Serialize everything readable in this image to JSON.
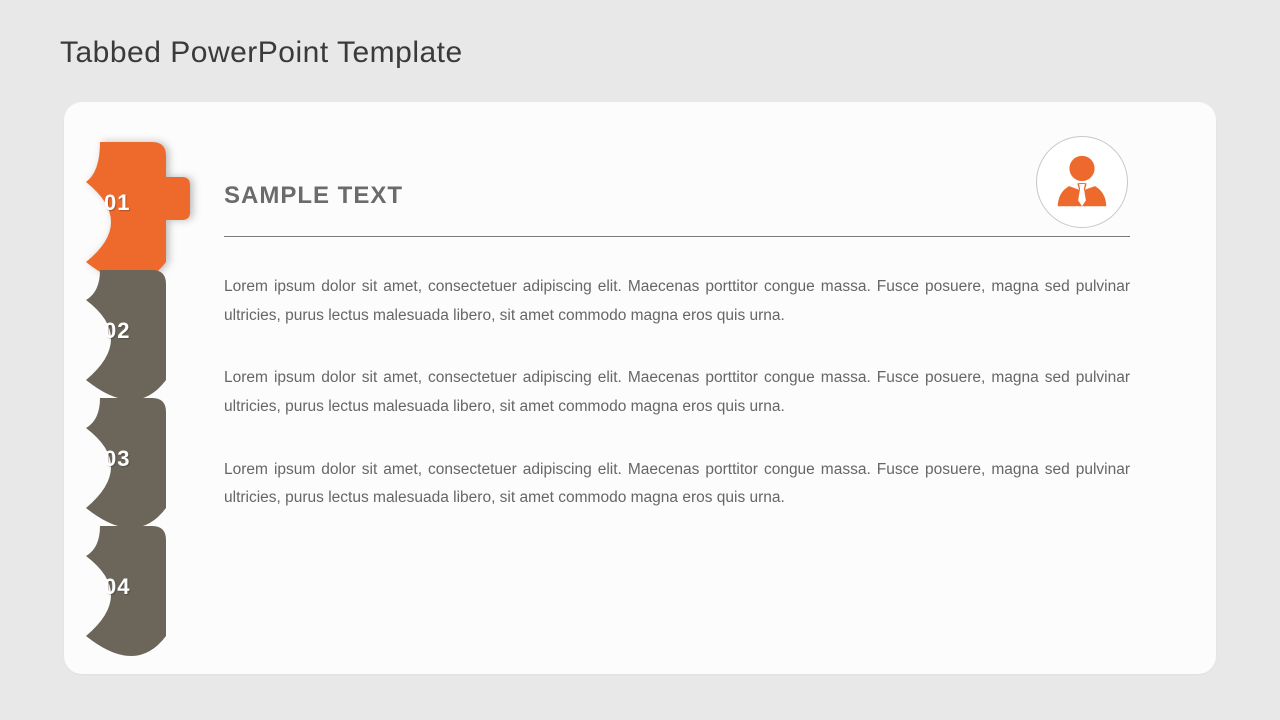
{
  "title": "Tabbed PowerPoint Template",
  "colors": {
    "accent": "#ed6a2c",
    "tab_inactive": "#6c655a",
    "text_heading": "#6b6b6b",
    "text_body": "#666666"
  },
  "tabs": [
    {
      "num": "01",
      "active": true
    },
    {
      "num": "02",
      "active": false
    },
    {
      "num": "03",
      "active": false
    },
    {
      "num": "04",
      "active": false
    }
  ],
  "content": {
    "heading": "SAMPLE TEXT",
    "paragraphs": [
      "Lorem ipsum dolor sit amet, consectetuer adipiscing elit. Maecenas porttitor congue massa. Fusce posuere, magna sed pulvinar ultricies, purus lectus malesuada libero, sit amet commodo magna eros quis urna.",
      "Lorem ipsum dolor sit amet, consectetuer adipiscing elit. Maecenas porttitor congue massa. Fusce posuere, magna sed pulvinar ultricies, purus lectus malesuada libero, sit amet commodo magna eros quis urna.",
      "Lorem ipsum dolor sit amet, consectetuer adipiscing elit. Maecenas porttitor congue massa. Fusce posuere, magna sed pulvinar ultricies, purus lectus malesuada libero, sit amet commodo magna eros quis urna."
    ]
  },
  "icon": "person-icon"
}
